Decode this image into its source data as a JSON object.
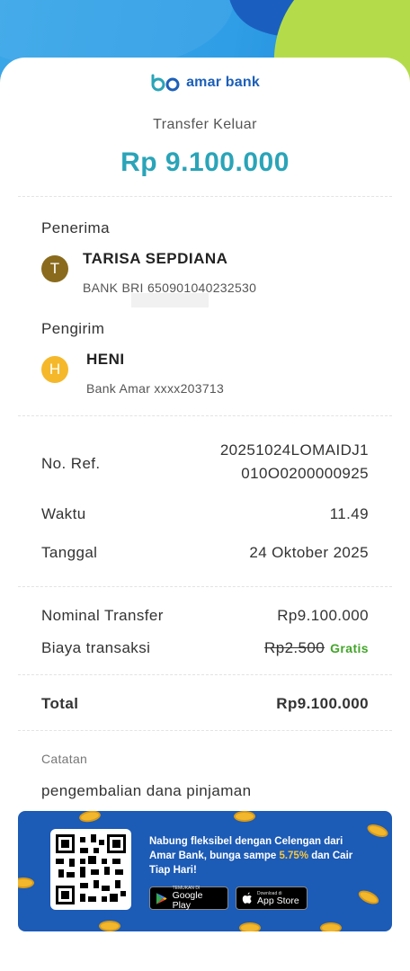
{
  "brand": {
    "name": "amar bank"
  },
  "header": {
    "title": "Transfer Keluar",
    "amount": "Rp 9.100.000"
  },
  "recipient": {
    "label": "Penerima",
    "initial": "T",
    "name": "TARISA SEPDIANA",
    "account": "BANK BRI 650901040232530",
    "avatar_color": "#8a6a1c"
  },
  "sender": {
    "label": "Pengirim",
    "initial": "H",
    "name": "HENI",
    "account": "Bank Amar xxxx203713",
    "avatar_color": "#f5b82a"
  },
  "details": {
    "ref_label": "No. Ref.",
    "ref_line1": "20251024LOMAIDJ1",
    "ref_line2": "010O0200000925",
    "time_label": "Waktu",
    "time_value": "11.49",
    "date_label": "Tanggal",
    "date_value": "24 Oktober 2025"
  },
  "costs": {
    "nominal_label": "Nominal Transfer",
    "nominal_value": "Rp9.100.000",
    "fee_label": "Biaya transaksi",
    "fee_value": "Rp2.500",
    "fee_badge": "Gratis"
  },
  "total": {
    "label": "Total",
    "value": "Rp9.100.000"
  },
  "note": {
    "label": "Catatan",
    "value": "pengembalian dana pinjaman"
  },
  "banner": {
    "text_part1": "Nabung fleksibel dengan Celengan dari Amar Bank, bunga sampe ",
    "rate": "5.75%",
    "text_part2": " dan Cair Tiap Hari!",
    "google_small": "TEMUKAN DI",
    "google_big": "Google Play",
    "apple_small": "Download di",
    "apple_big": "App Store"
  },
  "colors": {
    "accent_amount": "#2aa4b8",
    "brand_blue": "#1c5fb8",
    "gratis_green": "#43a52a",
    "banner_blue": "#1c5bb6"
  }
}
